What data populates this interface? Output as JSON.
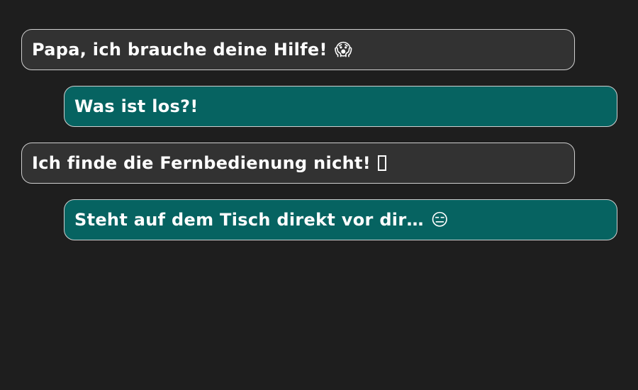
{
  "messages": [
    {
      "sender": "incoming",
      "text": "Papa, ich brauche deine Hilfe!",
      "emoji": "😱",
      "emoji_icon": "screaming-face-icon"
    },
    {
      "sender": "outgoing",
      "text": "Was ist los?!",
      "emoji": "",
      "emoji_icon": ""
    },
    {
      "sender": "incoming",
      "text": "Ich finde die Fernbedienung nicht!",
      "emoji": "",
      "emoji_icon": "missing-glyph-icon"
    },
    {
      "sender": "outgoing",
      "text": "Steht auf dem Tisch direkt vor dir…",
      "emoji": "😑",
      "emoji_icon": "expressionless-face-icon"
    }
  ],
  "colors": {
    "background": "#1e1e1e",
    "incoming_bubble": "#323232",
    "outgoing_bubble": "#066361",
    "bubble_border": "#cfcfcf",
    "text": "#ffffff"
  }
}
